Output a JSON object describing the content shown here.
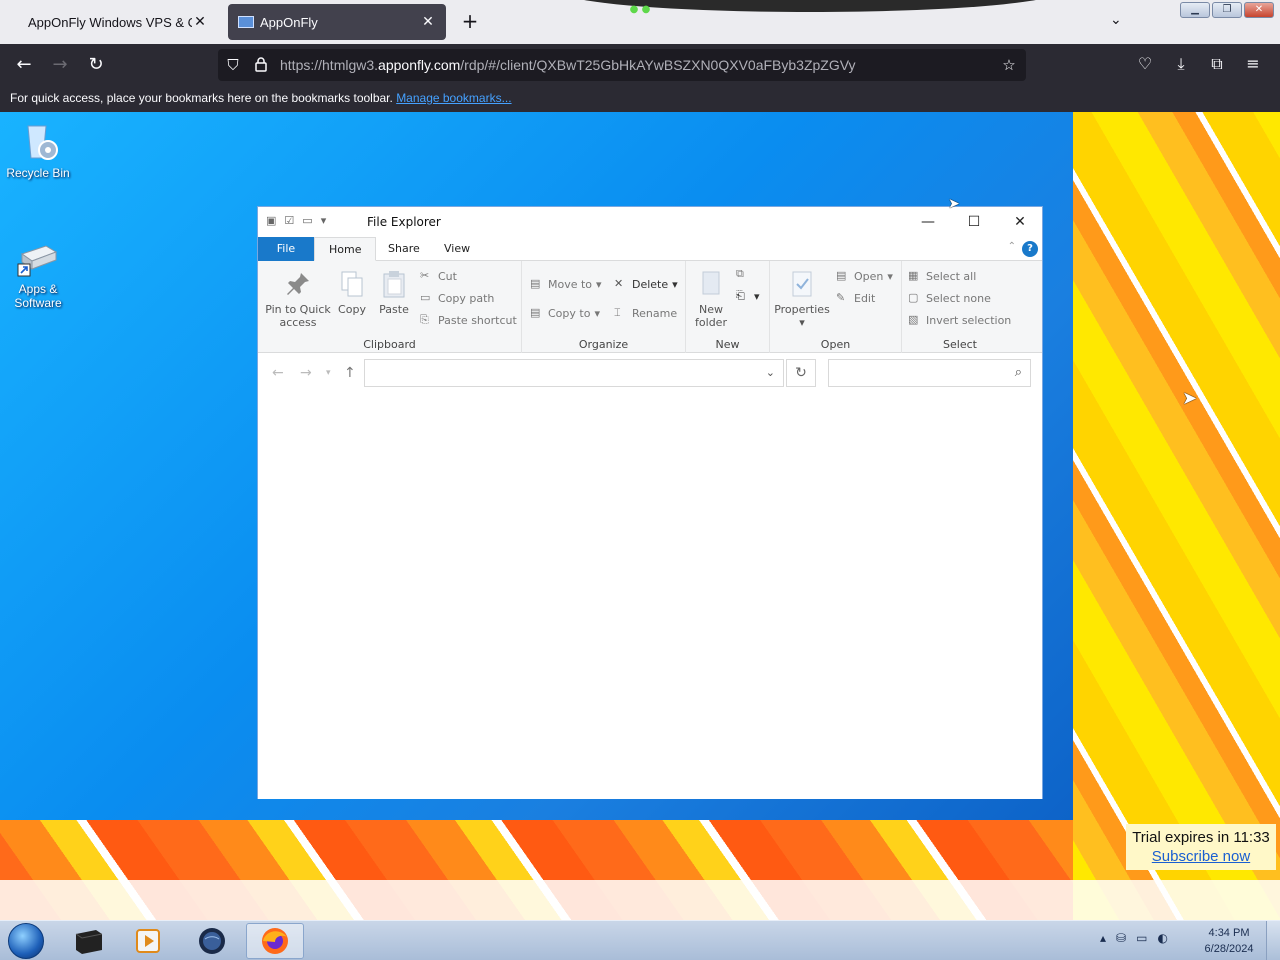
{
  "browser": {
    "tabs": [
      {
        "label": "AppOnFly Windows VPS & Clou",
        "close_icon": "✕"
      },
      {
        "label": "AppOnFly",
        "close_icon": "✕"
      }
    ],
    "new_tab": "+",
    "tab_list": "⌄",
    "url": {
      "prefix": "https://htmlgw3.",
      "host": "apponfly.com",
      "path": "/rdp/#/client/QXBwT25GbHkAYwBSZXN0QXV0aFByb3ZpZGVy"
    },
    "bookmarks_bar": {
      "message": "For quick access, place your bookmarks here on the bookmarks toolbar. ",
      "link": "Manage bookmarks..."
    }
  },
  "desktop": {
    "icons": [
      {
        "label": "Recycle Bin"
      },
      {
        "label": "Apps & Software"
      }
    ],
    "trial": {
      "text": "Trial expires in 11:33",
      "link": "Subscribe now"
    }
  },
  "explorer": {
    "title": "File Explorer",
    "tabs": {
      "file": "File",
      "home": "Home",
      "share": "Share",
      "view": "View"
    },
    "help": "?",
    "clipboard": {
      "pin": "Pin to Quick access",
      "copy": "Copy",
      "paste": "Paste",
      "cut": "Cut",
      "copy_path": "Copy path",
      "paste_shortcut": "Paste shortcut",
      "label": "Clipboard"
    },
    "organize": {
      "move_to": "Move to",
      "copy_to": "Copy to",
      "delete": "Delete",
      "rename": "Rename",
      "label": "Organize"
    },
    "new": {
      "new_folder": "New folder",
      "label": "New"
    },
    "open": {
      "properties": "Properties",
      "open": "Open",
      "edit": "Edit",
      "label": "Open"
    },
    "select": {
      "select_all": "Select all",
      "select_none": "Select none",
      "invert": "Invert selection",
      "label": "Select"
    },
    "address": {
      "value": ""
    },
    "search": {
      "value": ""
    }
  },
  "taskbar": {
    "clock": {
      "time": "4:34 PM",
      "date": "6/28/2024"
    }
  },
  "colors": {
    "accent": "#1979ca",
    "browser_dark": "#2b2a33",
    "desktop_blue": "#0a8df0"
  }
}
